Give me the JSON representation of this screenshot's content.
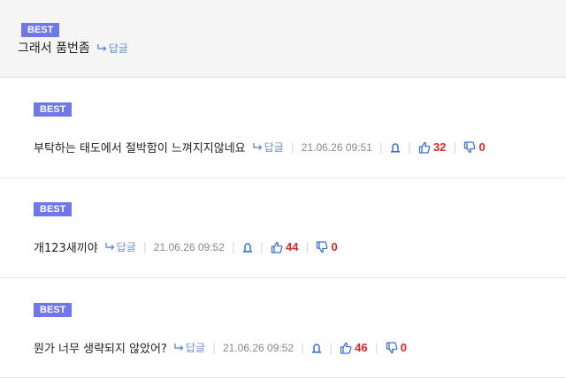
{
  "colors": {
    "badge_bg": "#6f78e6",
    "link": "#6a8fc8",
    "count": "#e02424",
    "thumb": "#3a6fd8"
  },
  "top_comment": {
    "badge": "BEST",
    "text": "그래서 품번좀",
    "reply_label": "답글"
  },
  "replies": [
    {
      "badge": "BEST",
      "text": "부탁하는 태도에서 절박함이 느껴지지않네요",
      "reply_label": "답글",
      "timestamp": "21.06.26 09:51",
      "up": "32",
      "down": "0"
    },
    {
      "badge": "BEST",
      "text": "개123새끼야",
      "reply_label": "답글",
      "timestamp": "21.06.26 09:52",
      "up": "44",
      "down": "0"
    },
    {
      "badge": "BEST",
      "text": "뭔가 너무 생략되지 않았어?",
      "reply_label": "답글",
      "timestamp": "21.06.26 09:52",
      "up": "46",
      "down": "0"
    }
  ],
  "icons": {
    "reply": "reply-arrow-icon",
    "report": "report-bell-icon",
    "like": "thumbs-up-icon",
    "dislike": "thumbs-down-icon"
  }
}
